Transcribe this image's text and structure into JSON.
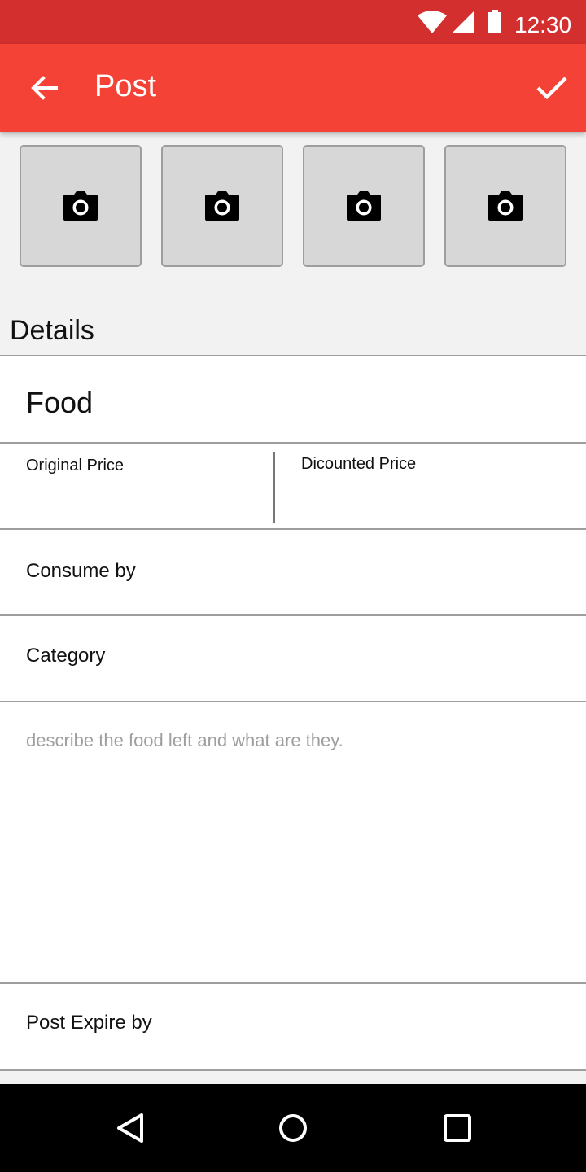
{
  "status_bar": {
    "time": "12:30",
    "icons": [
      "wifi-icon",
      "cell-signal-icon",
      "battery-icon"
    ]
  },
  "app_bar": {
    "title": "Post",
    "back_icon": "arrow-back-icon",
    "confirm_icon": "check-icon",
    "color": "#f44336"
  },
  "photos": {
    "slots": 4,
    "icon": "camera-icon"
  },
  "details": {
    "heading": "Details",
    "food_label": "Food",
    "original_price_label": "Original Price",
    "discounted_price_label": "Dicounted Price",
    "consume_by_label": "Consume by",
    "category_label": "Category",
    "description_placeholder": "describe the food left and what are they.",
    "post_expire_label": "Post Expire by"
  },
  "nav_bar": {
    "icons": [
      "back-triangle-icon",
      "home-circle-icon",
      "recents-square-icon"
    ]
  },
  "colors": {
    "status_bar": "#d32f2f",
    "accent": "#f44336",
    "background": "#f2f2f2"
  }
}
